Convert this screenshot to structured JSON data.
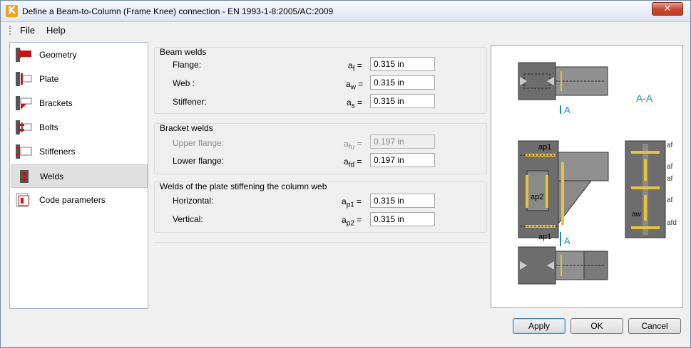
{
  "window": {
    "title": "Define a Beam-to-Column (Frame Knee) connection - EN 1993-1-8:2005/AC:2009",
    "app_icon": "K",
    "close_glyph": "✕"
  },
  "menu": {
    "file": "File",
    "help": "Help"
  },
  "nav": {
    "items": [
      {
        "label": "Geometry",
        "icon": "geometry-icon"
      },
      {
        "label": "Plate",
        "icon": "plate-icon"
      },
      {
        "label": "Brackets",
        "icon": "brackets-icon"
      },
      {
        "label": "Bolts",
        "icon": "bolts-icon"
      },
      {
        "label": "Stiffeners",
        "icon": "stiffeners-icon"
      },
      {
        "label": "Welds",
        "icon": "welds-icon",
        "selected": true
      },
      {
        "label": "Code parameters",
        "icon": "code-parameters-icon"
      }
    ]
  },
  "beam_welds": {
    "title": "Beam welds",
    "flange": {
      "label": "Flange:",
      "sym": "a",
      "sub": "f",
      "eq": " =",
      "value": "0.315 in"
    },
    "web": {
      "label": "Web :",
      "sym": "a",
      "sub": "w",
      "eq": " =",
      "value": "0.315 in"
    },
    "stiffener": {
      "label": "Stiffener:",
      "sym": "a",
      "sub": "s",
      "eq": " =",
      "value": "0.315 in"
    }
  },
  "bracket_welds": {
    "title": "Bracket welds",
    "upper": {
      "label": "Upper flange:",
      "sym": "a",
      "sub": "fu",
      "eq": " =",
      "value": "0.197 in"
    },
    "lower": {
      "label": "Lower flange:",
      "sym": "a",
      "sub": "fd",
      "eq": " =",
      "value": "0.197 in"
    }
  },
  "plate_welds": {
    "title": "Welds of the plate stiffening the column web",
    "horizontal": {
      "label": "Horizontal:",
      "sym": "a",
      "sub": "p1",
      "eq": " =",
      "value": "0.315 in"
    },
    "vertical": {
      "label": "Vertical:",
      "sym": "a",
      "sub": "p2",
      "eq": " =",
      "value": "0.315 in"
    }
  },
  "diagram": {
    "section_label": "A-A",
    "cut_a_top": "A",
    "cut_a_bottom": "A",
    "ap1_top": "ap1",
    "ap2": "ap2",
    "ap1_bottom": "ap1",
    "aw": "aw",
    "af_1": "af",
    "af_2": "af",
    "af_3": "af",
    "af_4": "af",
    "afd": "afd"
  },
  "buttons": {
    "apply": "Apply",
    "ok": "OK",
    "cancel": "Cancel"
  },
  "colors": {
    "steel": "#6d6d6d",
    "weld": "#e7c43a",
    "accent": "#1e88d8",
    "red_icon": "#d01010"
  }
}
